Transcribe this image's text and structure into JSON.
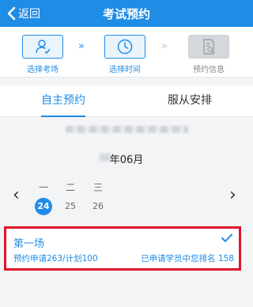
{
  "header": {
    "back_label": "返回",
    "title": "考试预约"
  },
  "steps": [
    {
      "label": "选择考场",
      "icon": "user-check-icon",
      "state": "active"
    },
    {
      "label": "选择时间",
      "icon": "clock-icon",
      "state": "active"
    },
    {
      "label": "预约信息",
      "icon": "document-search-icon",
      "state": "inactive"
    }
  ],
  "step_arrows": [
    "»",
    "»"
  ],
  "tabs": [
    {
      "label": "自主预约",
      "active": true
    },
    {
      "label": "服从安排",
      "active": false
    }
  ],
  "calendar": {
    "month_label": "年06月",
    "prev_arrow": "‹",
    "next_arrow": "›",
    "weekdays": [
      "一",
      "二",
      "三"
    ],
    "days": [
      "24",
      "25",
      "26"
    ],
    "selected_day": "24"
  },
  "session": {
    "name": "第一场",
    "quota": "预约申请263/计划100",
    "rank": "已申请学员中您排名  158"
  },
  "colors": {
    "primary": "#1f8ce6",
    "highlight_border": "#e0162b",
    "inactive_step": "#d4d7dc"
  }
}
